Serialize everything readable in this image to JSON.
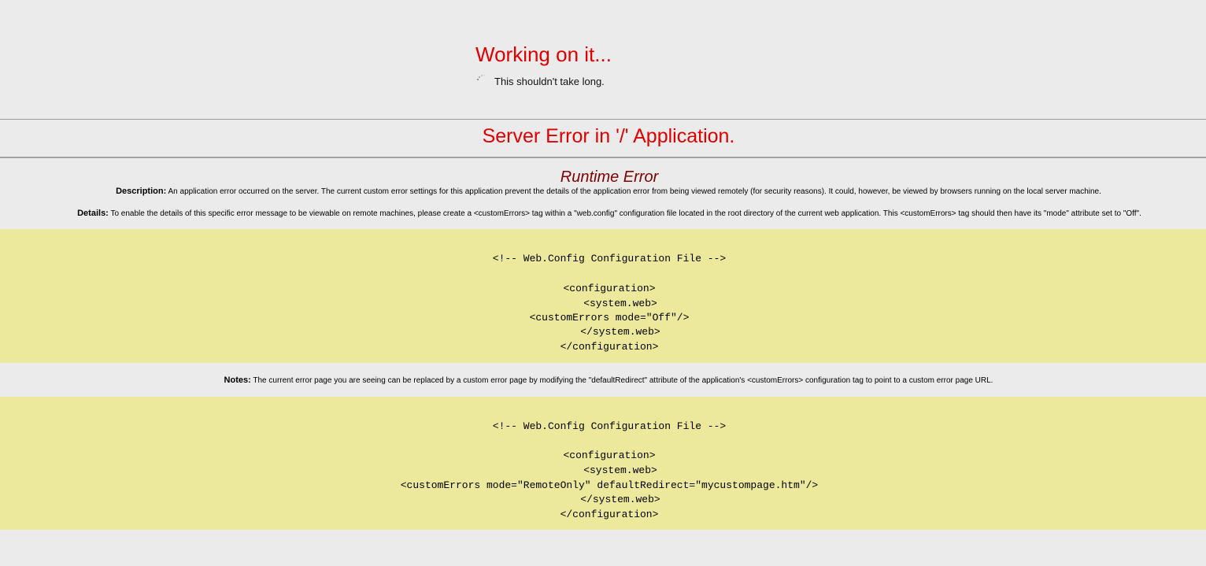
{
  "working": {
    "title": "Working on it...",
    "subtitle": "This shouldn't take long.",
    "icon": "spinner-icon"
  },
  "error": {
    "title": "Server Error in '/' Application.",
    "subtitle": "Runtime Error",
    "description_label": "Description:",
    "description_text": "An application error occurred on the server. The current custom error settings for this application prevent the details of the application error from being viewed remotely (for security reasons). It could, however, be viewed by browsers running on the local server machine.",
    "details_label": "Details:",
    "details_text": "To enable the details of this specific error message to be viewable on remote machines, please create a <customErrors> tag within a \"web.config\" configuration file located in the root directory of the current web application. This <customErrors> tag should then have its \"mode\" attribute set to \"Off\".",
    "notes_label": "Notes:",
    "notes_text": "The current error page you are seeing can be replaced by a custom error page by modifying the \"defaultRedirect\" attribute of the application's <customErrors> configuration tag to point to a custom error page URL."
  },
  "code1": {
    "comment": "<!-- Web.Config Configuration File -->",
    "lines": [
      "<configuration>",
      "<system.web>",
      "<customErrors mode=\"Off\"/>",
      "</system.web>",
      "</configuration>"
    ]
  },
  "code2": {
    "comment": "<!-- Web.Config Configuration File -->",
    "lines": [
      "<configuration>",
      "<system.web>",
      "<customErrors mode=\"RemoteOnly\" defaultRedirect=\"mycustompage.htm\"/>",
      "</system.web>",
      "</configuration>"
    ]
  },
  "colors": {
    "background": "#ebebeb",
    "error_red": "#e00000",
    "runtime_maroon": "#800000",
    "code_background": "#ece99c"
  }
}
